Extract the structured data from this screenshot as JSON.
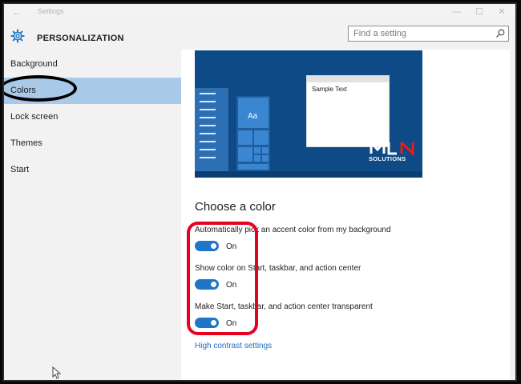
{
  "titlebar": {
    "title": "Settings",
    "back_icon": "back-arrow-icon",
    "minimize_icon": "minimize-icon",
    "maximize_icon": "maximize-icon",
    "close_icon": "close-icon"
  },
  "header": {
    "icon": "gear-icon",
    "title": "PERSONALIZATION",
    "search": {
      "placeholder": "Find a setting",
      "value": "",
      "icon": "search-icon"
    }
  },
  "sidebar": {
    "items": [
      {
        "label": "Background",
        "selected": false
      },
      {
        "label": "Colors",
        "selected": true
      },
      {
        "label": "Lock screen",
        "selected": false
      },
      {
        "label": "Themes",
        "selected": false
      },
      {
        "label": "Start",
        "selected": false
      }
    ],
    "selected_color": "#a9c9e8"
  },
  "preview": {
    "tile_text": "Aa",
    "sample_text": "Sample Text",
    "logo_text": "SOLUTIONS",
    "logo_subtext": "",
    "accent_color": "#0d4a86"
  },
  "main": {
    "section_title": "Choose a color",
    "settings": [
      {
        "label": "Automatically pick an accent color from my background",
        "state": "On",
        "on": true
      },
      {
        "label": "Show color on Start, taskbar, and action center",
        "state": "On",
        "on": true
      },
      {
        "label": "Make Start, taskbar, and action center transparent",
        "state": "On",
        "on": true
      }
    ],
    "link": "High contrast settings",
    "toggle_color": "#1e76c8",
    "link_color": "#1a6fc4"
  },
  "annotations": {
    "oval_color": "#000000",
    "box_color": "#e8001f"
  }
}
